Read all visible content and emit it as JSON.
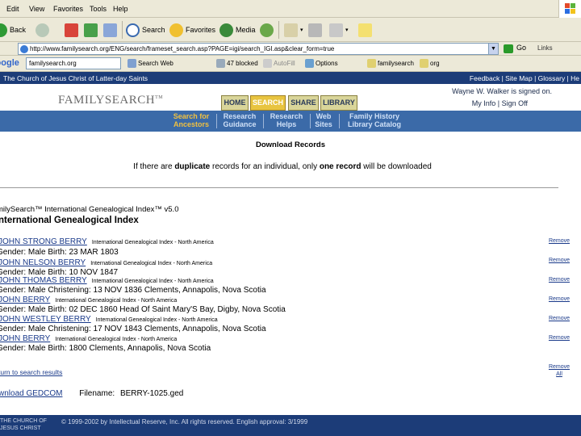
{
  "browser": {
    "menu": [
      "Edit",
      "View",
      "Favorites",
      "Tools",
      "Help"
    ],
    "toolbar": {
      "back": "Back",
      "search": "Search",
      "favorites": "Favorites",
      "media": "Media"
    },
    "address": "http://www.familysearch.org/ENG/search/frameset_search.asp?PAGE=igi/search_IGI.asp&clear_form=true",
    "go": "Go",
    "links": "Links",
    "google": {
      "logo": "Google",
      "query": "familysearch.org",
      "search_web": "Search Web",
      "blocked": "47 blocked",
      "autofill": "AutoFill",
      "options": "Options",
      "bookmark1": "familysearch",
      "bookmark2": "org"
    }
  },
  "site": {
    "church_name": "The Church of Jesus Christ of Latter-day Saints",
    "utility_links": "Feedback | Site Map | Glossary | He",
    "logo": "FAMILYSEARCH",
    "logo_tm": "TM",
    "tabs": [
      {
        "label": "HOME",
        "active": false
      },
      {
        "label": "SEARCH",
        "active": true
      },
      {
        "label": "SHARE",
        "active": false
      },
      {
        "label": "LIBRARY",
        "active": false
      }
    ],
    "welcome": "Wayne W. Walker is signed on.",
    "account": "My Info | Sign Off",
    "subnav": [
      {
        "line1": "Search for",
        "line2": "Ancestors",
        "current": true
      },
      {
        "line1": "Research",
        "line2": "Guidance",
        "current": false
      },
      {
        "line1": "Research",
        "line2": "Helps",
        "current": false
      },
      {
        "line1": "Web",
        "line2": "Sites",
        "current": false
      },
      {
        "line1": "Family History",
        "line2": "Library Catalog",
        "current": false
      }
    ]
  },
  "page": {
    "title": "Download Records",
    "note_pre": "If there are ",
    "note_dup": "duplicate",
    "note_mid": " records for an individual, only ",
    "note_one": "one record",
    "note_post": " will be downloaded",
    "breadcrumb": "milySearch™ International Genealogical Index™ v5.0",
    "section_title": "nternational Genealogical Index",
    "records": [
      {
        "name": "JOHN STRONG BERRY",
        "source": "International Genealogical Index - North America",
        "detail": "Gender: Male Birth: 23 MAR 1803",
        "remove": "Remove"
      },
      {
        "name": "JOHN NELSON BERRY",
        "source": "International Genealogical Index - North America",
        "detail": "Gender: Male Birth: 10 NOV 1847",
        "remove": "Remove"
      },
      {
        "name": "JOHN THOMAS BERRY",
        "source": "International Genealogical Index - North America",
        "detail": "Gender: Male Christening: 13 NOV 1836 Clements, Annapolis, Nova Scotia",
        "remove": "Remove"
      },
      {
        "name": "JOHN BERRY",
        "source": "International Genealogical Index - North America",
        "detail": "Gender: Male Birth: 02 DEC 1860 Head Of Saint Mary'S Bay, Digby, Nova Scotia",
        "remove": "Remove"
      },
      {
        "name": "JOHN WESTLEY BERRY",
        "source": "International Genealogical Index - North America",
        "detail": "Gender: Male Christening: 17 NOV 1843 Clements, Annapolis, Nova Scotia",
        "remove": "Remove"
      },
      {
        "name": "JOHN BERRY",
        "source": "International Genealogical Index - North America",
        "detail": "Gender: Male Birth: 1800 Clements, Annapolis, Nova Scotia",
        "remove": "Remove"
      }
    ],
    "return_link": "turn to search results",
    "remove_all": "Remove All",
    "download_link": "wnload GEDCOM",
    "filename_label": "Filename:",
    "filename_value": "BERRY-1025.ged"
  },
  "footer": {
    "church_line1": "THE CHURCH OF",
    "church_line2": "JESUS CHRIST",
    "copyright": "© 1999-2002 by Intellectual Reserve, Inc. All rights reserved. English approval: 3/1999"
  },
  "colors": {
    "site_navy": "#1c3c78",
    "subnav_blue": "#3b6aa8",
    "tab_gold": "#e8c440",
    "tab_khaki": "#d9d59a",
    "link_blue": "#1a3a8a",
    "chrome": "#ece9d8"
  }
}
